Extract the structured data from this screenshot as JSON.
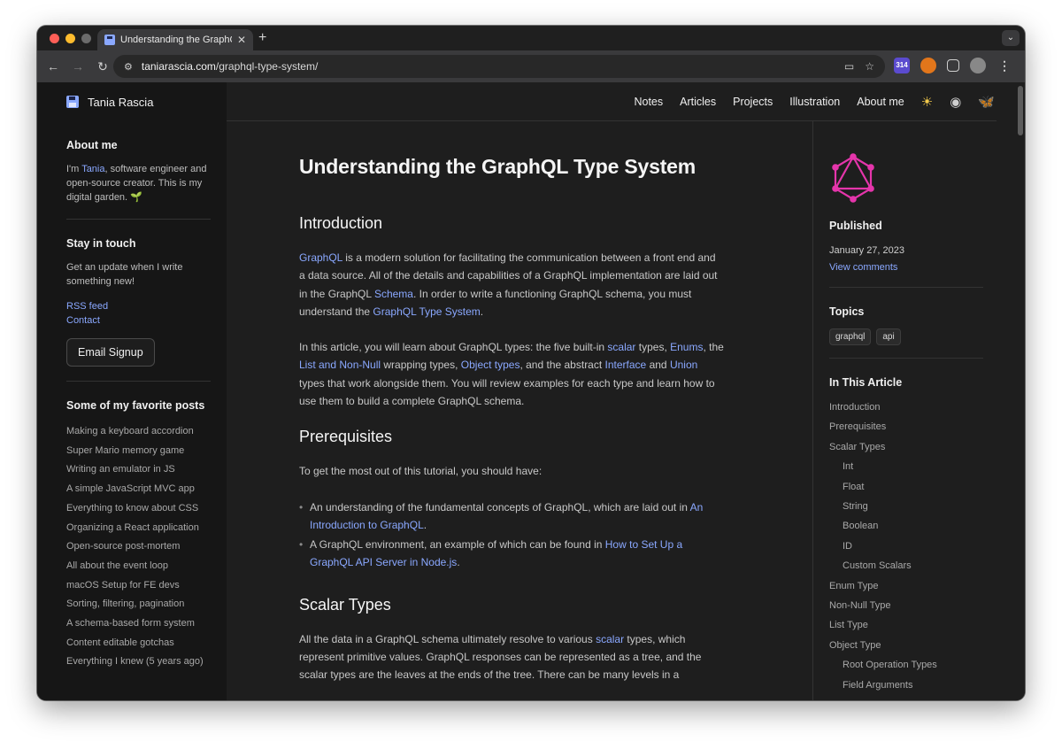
{
  "browser": {
    "tab_title": "Understanding the GraphQL T",
    "url_host": "taniarascia.com",
    "url_path": "/graphql-type-system/",
    "ext_badge": "314"
  },
  "site": {
    "brand": "Tania Rascia"
  },
  "nav": {
    "items": [
      "Notes",
      "Articles",
      "Projects",
      "Illustration",
      "About me"
    ]
  },
  "left": {
    "about_title": "About me",
    "about_pre": "I'm ",
    "about_name": "Tania",
    "about_post": ", software engineer and open-source creator. This is my digital garden. 🌱",
    "touch_title": "Stay in touch",
    "touch_text": "Get an update when I write something new!",
    "rss": "RSS feed",
    "contact": "Contact",
    "signup": "Email Signup",
    "posts_title": "Some of my favorite posts",
    "posts": [
      "Making a keyboard accordion",
      "Super Mario memory game",
      "Writing an emulator in JS",
      "A simple JavaScript MVC app",
      "Everything to know about CSS",
      "Organizing a React application",
      "Open-source post-mortem",
      "All about the event loop",
      "macOS Setup for FE devs",
      "Sorting, filtering, pagination",
      "A schema-based form system",
      "Content editable gotchas",
      "Everything I knew (5 years ago)"
    ]
  },
  "article": {
    "title": "Understanding the GraphQL Type System",
    "intro_heading": "Introduction",
    "p1": {
      "a1": "GraphQL",
      "t1": " is a modern solution for facilitating the communication between a front end and a data source. All of the details and capabilities of a GraphQL implementation are laid out in the GraphQL ",
      "a2": "Schema",
      "t2": ". In order to write a functioning GraphQL schema, you must understand the ",
      "a3": "GraphQL Type System",
      "t3": "."
    },
    "p2": {
      "t1": "In this article, you will learn about GraphQL types: the five built-in ",
      "a1": "scalar",
      "t2": " types, ",
      "a2": "Enums",
      "t3": ", the ",
      "a3": "List and Non-Null",
      "t4": " wrapping types, ",
      "a4": "Object types",
      "t5": ", and the abstract ",
      "a5": "Interface",
      "t6": " and ",
      "a6": "Union",
      "t7": " types that work alongside them. You will review examples for each type and learn how to use them to build a complete GraphQL schema."
    },
    "prereq_heading": "Prerequisites",
    "prereq_text": "To get the most out of this tutorial, you should have:",
    "li1": {
      "t1": "An understanding of the fundamental concepts of GraphQL, which are laid out in ",
      "a1": "An Introduction to GraphQL",
      "t2": "."
    },
    "li2": {
      "t1": "A GraphQL environment, an example of which can be found in ",
      "a1": "How to Set Up a GraphQL API Server in Node.js",
      "t2": "."
    },
    "scalar_heading": "Scalar Types",
    "p3": {
      "t1": "All the data in a GraphQL schema ultimately resolve to various ",
      "a1": "scalar",
      "t2": " types, which represent primitive values. GraphQL responses can be represented as a tree, and the scalar types are the leaves at the ends of the tree. There can be many levels in a"
    }
  },
  "right": {
    "published_label": "Published",
    "date": "January 27, 2023",
    "comments": "View comments",
    "topics_label": "Topics",
    "topics": [
      "graphql",
      "api"
    ],
    "toc_label": "In This Article",
    "toc": [
      {
        "label": "Introduction",
        "sub": false
      },
      {
        "label": "Prerequisites",
        "sub": false
      },
      {
        "label": "Scalar Types",
        "sub": false
      },
      {
        "label": "Int",
        "sub": true
      },
      {
        "label": "Float",
        "sub": true
      },
      {
        "label": "String",
        "sub": true
      },
      {
        "label": "Boolean",
        "sub": true
      },
      {
        "label": "ID",
        "sub": true
      },
      {
        "label": "Custom Scalars",
        "sub": true
      },
      {
        "label": "Enum Type",
        "sub": false
      },
      {
        "label": "Non-Null Type",
        "sub": false
      },
      {
        "label": "List Type",
        "sub": false
      },
      {
        "label": "Object Type",
        "sub": false
      },
      {
        "label": "Root Operation Types",
        "sub": true
      },
      {
        "label": "Field Arguments",
        "sub": true
      }
    ]
  },
  "colors": {
    "link": "#8aa8ff",
    "graphql_pink": "#e535ab"
  }
}
